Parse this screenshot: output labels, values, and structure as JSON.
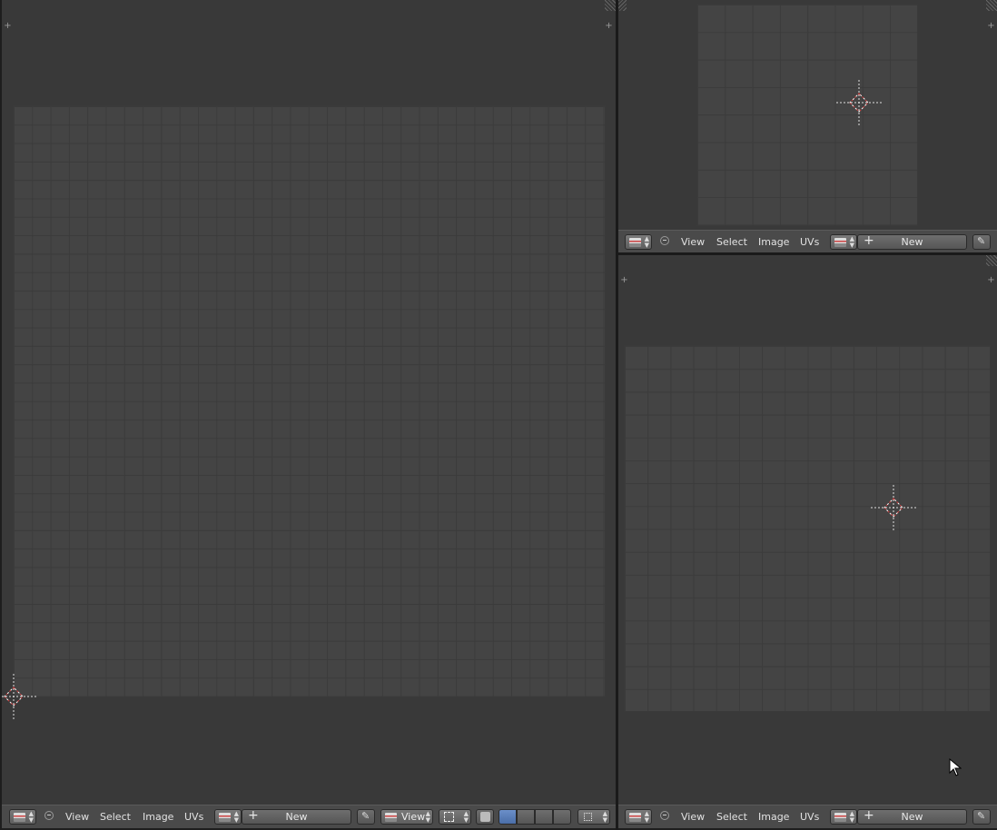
{
  "left_area": {
    "header": {
      "menu": [
        "View",
        "Select",
        "Image",
        "UVs"
      ],
      "new_label": "New",
      "view_label": "View"
    }
  },
  "top_right_area": {
    "header": {
      "menu": [
        "View",
        "Select",
        "Image",
        "UVs"
      ],
      "new_label": "New"
    }
  },
  "bottom_right_area": {
    "header": {
      "menu": [
        "View",
        "Select",
        "Image",
        "UVs"
      ],
      "new_label": "New"
    }
  },
  "icons": {
    "editor_type": "image-editor-icon",
    "collapse": "collapse-menu-icon",
    "image_browse": "image-browse-icon",
    "new_plus": "plus-icon",
    "pin": "pin-icon",
    "cursor": "mouse-pointer-icon"
  },
  "colors": {
    "background": "#393939",
    "grid": "#444444",
    "header": "#4a4a4a",
    "cursor_red": "#d04040"
  }
}
